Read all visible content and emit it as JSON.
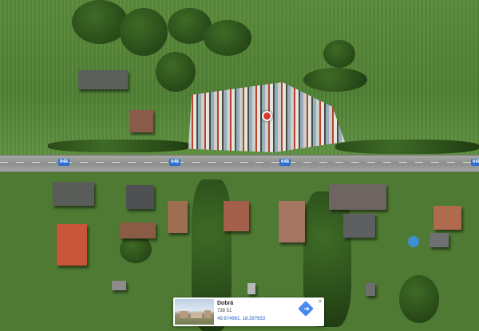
{
  "map": {
    "road_number": "648",
    "road_shield_color": "#2f6fcf",
    "marker_icon": "location-pin-icon"
  },
  "place_card": {
    "title": "Dobrá",
    "postal_code": "739 51",
    "coordinates": "49.674961, 18.397933",
    "directions_icon": "directions-icon",
    "close_icon": "close-icon",
    "directions_color": "#4a89f3"
  }
}
